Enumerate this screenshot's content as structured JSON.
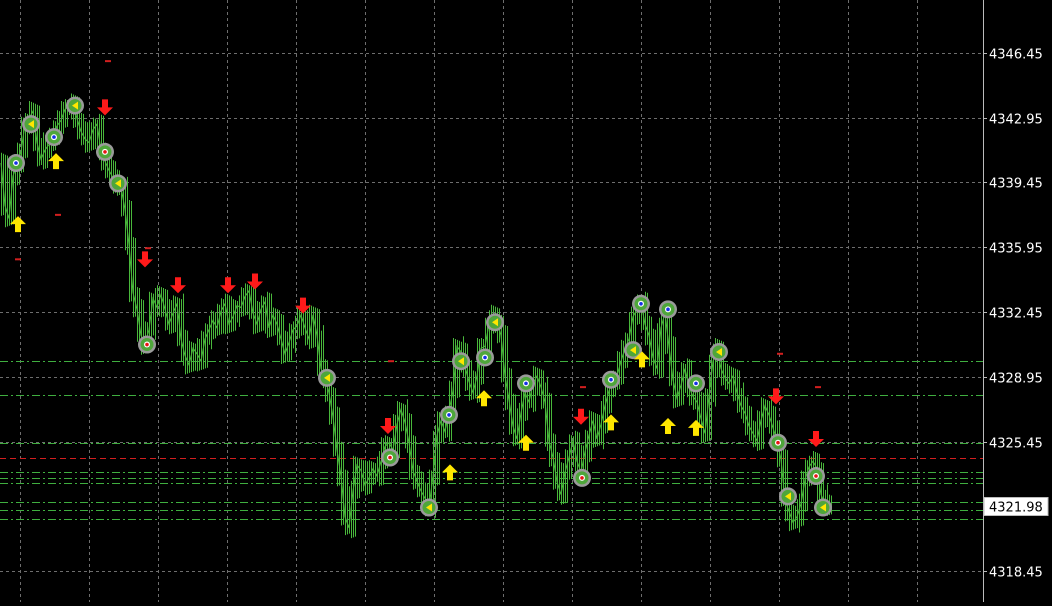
{
  "chart_data": {
    "type": "line",
    "title": "",
    "xlabel": "",
    "ylabel": "",
    "ylim": [
      4316.8,
      4349.3
    ],
    "grid": true,
    "y_ticks": [
      "4346.45",
      "4342.95",
      "4339.45",
      "4335.95",
      "4332.45",
      "4328.95",
      "4325.45",
      "4321.98",
      "4318.45"
    ],
    "current_price": "4321.98",
    "colors": {
      "background": "#000000",
      "grid": "#6e6e6e",
      "price": "#49b83b",
      "buy_arrow": "#ffe600",
      "sell_arrow": "#ff1a1a",
      "level_line": "#3fae3f",
      "red_level": "#d21f1f"
    },
    "series": [
      {
        "values": [
          [
            0,
            4340.5
          ],
          [
            4,
            4338.2
          ],
          [
            8,
            4337.5
          ],
          [
            12,
            4339.8
          ],
          [
            16,
            4340.4
          ],
          [
            20,
            4341.1
          ],
          [
            24,
            4342.6
          ],
          [
            28,
            4342.9
          ],
          [
            32,
            4343.3
          ],
          [
            36,
            4341.6
          ],
          [
            40,
            4340.7
          ],
          [
            44,
            4341.2
          ],
          [
            48,
            4341.5
          ],
          [
            52,
            4342.0
          ],
          [
            56,
            4342.5
          ],
          [
            60,
            4342.8
          ],
          [
            64,
            4343.4
          ],
          [
            68,
            4343.6
          ],
          [
            72,
            4343.7
          ],
          [
            76,
            4342.9
          ],
          [
            80,
            4342.2
          ],
          [
            84,
            4341.8
          ],
          [
            88,
            4341.6
          ],
          [
            92,
            4342.3
          ],
          [
            96,
            4342.6
          ],
          [
            100,
            4341.2
          ],
          [
            104,
            4340.6
          ],
          [
            108,
            4340.1
          ],
          [
            112,
            4339.7
          ],
          [
            116,
            4339.4
          ],
          [
            120,
            4339.2
          ],
          [
            124,
            4338.0
          ],
          [
            128,
            4336.1
          ],
          [
            132,
            4333.5
          ],
          [
            136,
            4332.6
          ],
          [
            140,
            4331.2
          ],
          [
            144,
            4330.7
          ],
          [
            148,
            4331.5
          ],
          [
            152,
            4333.2
          ],
          [
            156,
            4332.7
          ],
          [
            160,
            4333.4
          ],
          [
            164,
            4332.6
          ],
          [
            168,
            4331.8
          ],
          [
            172,
            4332.4
          ],
          [
            176,
            4332.9
          ],
          [
            180,
            4331.0
          ],
          [
            184,
            4330.1
          ],
          [
            188,
            4329.6
          ],
          [
            192,
            4330.5
          ],
          [
            196,
            4330.2
          ],
          [
            200,
            4329.8
          ],
          [
            204,
            4331.0
          ],
          [
            208,
            4331.5
          ],
          [
            212,
            4332.0
          ],
          [
            216,
            4331.6
          ],
          [
            220,
            4332.5
          ],
          [
            224,
            4332.9
          ],
          [
            228,
            4331.8
          ],
          [
            232,
            4332.2
          ],
          [
            236,
            4332.8
          ],
          [
            240,
            4332.7
          ],
          [
            244,
            4333.3
          ],
          [
            248,
            4333.6
          ],
          [
            252,
            4332.4
          ],
          [
            256,
            4331.8
          ],
          [
            260,
            4332.6
          ],
          [
            264,
            4333.0
          ],
          [
            268,
            4331.6
          ],
          [
            272,
            4332.3
          ],
          [
            276,
            4331.8
          ],
          [
            280,
            4331.0
          ],
          [
            284,
            4330.2
          ],
          [
            288,
            4330.8
          ],
          [
            292,
            4331.5
          ],
          [
            296,
            4331.7
          ],
          [
            300,
            4332.3
          ],
          [
            304,
            4331.6
          ],
          [
            308,
            4331.0
          ],
          [
            312,
            4332.3
          ],
          [
            316,
            4331.2
          ],
          [
            320,
            4329.4
          ],
          [
            324,
            4328.9
          ],
          [
            328,
            4328.1
          ],
          [
            332,
            4326.8
          ],
          [
            336,
            4325.0
          ],
          [
            340,
            4323.6
          ],
          [
            344,
            4321.4
          ],
          [
            348,
            4320.8
          ],
          [
            352,
            4322.8
          ],
          [
            356,
            4324.2
          ],
          [
            360,
            4323.9
          ],
          [
            364,
            4323.1
          ],
          [
            368,
            4323.5
          ],
          [
            372,
            4324.0
          ],
          [
            376,
            4323.6
          ],
          [
            380,
            4324.4
          ],
          [
            384,
            4325.2
          ],
          [
            388,
            4325.4
          ],
          [
            392,
            4325.0
          ],
          [
            396,
            4326.4
          ],
          [
            400,
            4327.2
          ],
          [
            404,
            4326.5
          ],
          [
            408,
            4325.4
          ],
          [
            412,
            4323.9
          ],
          [
            416,
            4323.3
          ],
          [
            420,
            4322.8
          ],
          [
            424,
            4322.4
          ],
          [
            428,
            4321.9
          ],
          [
            432,
            4323.6
          ],
          [
            436,
            4325.8
          ],
          [
            440,
            4326.6
          ],
          [
            444,
            4326.0
          ],
          [
            448,
            4327.1
          ],
          [
            452,
            4328.2
          ],
          [
            456,
            4330.6
          ],
          [
            460,
            4330.3
          ],
          [
            464,
            4329.5
          ],
          [
            468,
            4328.7
          ],
          [
            472,
            4328.1
          ],
          [
            476,
            4329.0
          ],
          [
            480,
            4330.5
          ],
          [
            484,
            4330.6
          ],
          [
            488,
            4331.8
          ],
          [
            492,
            4332.3
          ],
          [
            496,
            4332.0
          ],
          [
            500,
            4331.2
          ],
          [
            504,
            4329.0
          ],
          [
            508,
            4327.7
          ],
          [
            512,
            4326.3
          ],
          [
            516,
            4325.6
          ],
          [
            520,
            4327.0
          ],
          [
            524,
            4328.1
          ],
          [
            528,
            4327.6
          ],
          [
            532,
            4328.6
          ],
          [
            536,
            4329.0
          ],
          [
            540,
            4328.4
          ],
          [
            544,
            4327.6
          ],
          [
            548,
            4325.5
          ],
          [
            552,
            4324.6
          ],
          [
            556,
            4323.3
          ],
          [
            560,
            4322.6
          ],
          [
            564,
            4323.8
          ],
          [
            568,
            4324.6
          ],
          [
            572,
            4325.5
          ],
          [
            576,
            4324.4
          ],
          [
            580,
            4323.8
          ],
          [
            584,
            4324.9
          ],
          [
            588,
            4325.8
          ],
          [
            592,
            4326.6
          ],
          [
            596,
            4325.6
          ],
          [
            600,
            4326.4
          ],
          [
            604,
            4327.4
          ],
          [
            608,
            4328.2
          ],
          [
            612,
            4328.8
          ],
          [
            616,
            4329.0
          ],
          [
            620,
            4329.8
          ],
          [
            624,
            4330.5
          ],
          [
            628,
            4331.0
          ],
          [
            632,
            4332.2
          ],
          [
            636,
            4332.6
          ],
          [
            640,
            4333.0
          ],
          [
            644,
            4331.8
          ],
          [
            648,
            4331.2
          ],
          [
            652,
            4330.0
          ],
          [
            656,
            4329.4
          ],
          [
            660,
            4331.6
          ],
          [
            664,
            4332.4
          ],
          [
            668,
            4330.6
          ],
          [
            672,
            4328.8
          ],
          [
            676,
            4327.8
          ],
          [
            680,
            4328.5
          ],
          [
            684,
            4329.4
          ],
          [
            688,
            4328.4
          ],
          [
            692,
            4327.9
          ],
          [
            696,
            4327.6
          ],
          [
            700,
            4326.7
          ],
          [
            704,
            4325.9
          ],
          [
            708,
            4327.9
          ],
          [
            712,
            4329.8
          ],
          [
            716,
            4330.5
          ],
          [
            720,
            4329.4
          ],
          [
            724,
            4328.9
          ],
          [
            728,
            4328.6
          ],
          [
            732,
            4329.0
          ],
          [
            736,
            4328.1
          ],
          [
            740,
            4327.4
          ],
          [
            744,
            4327.0
          ],
          [
            748,
            4326.3
          ],
          [
            752,
            4325.9
          ],
          [
            756,
            4325.5
          ],
          [
            760,
            4326.6
          ],
          [
            764,
            4327.4
          ],
          [
            768,
            4326.9
          ],
          [
            772,
            4326.2
          ],
          [
            776,
            4325.5
          ],
          [
            780,
            4324.5
          ],
          [
            784,
            4322.3
          ],
          [
            788,
            4321.7
          ],
          [
            792,
            4321.1
          ],
          [
            796,
            4321.4
          ],
          [
            800,
            4322.1
          ],
          [
            804,
            4323.4
          ],
          [
            808,
            4324.1
          ],
          [
            812,
            4324.4
          ],
          [
            816,
            4324.0
          ],
          [
            820,
            4322.6
          ],
          [
            824,
            4322.1
          ],
          [
            828,
            4322.0
          ]
        ]
      }
    ],
    "signals": [
      {
        "type": "buy",
        "x": 17,
        "y": 4337.2
      },
      {
        "type": "buy",
        "x": 55,
        "y": 4340.6
      },
      {
        "type": "sell",
        "x": 104,
        "y": 4343.5
      },
      {
        "type": "sell",
        "x": 144,
        "y": 4335.3
      },
      {
        "type": "sell",
        "x": 177,
        "y": 4333.9
      },
      {
        "type": "sell",
        "x": 227,
        "y": 4333.9
      },
      {
        "type": "sell",
        "x": 254,
        "y": 4334.1
      },
      {
        "type": "sell",
        "x": 302,
        "y": 4332.8
      },
      {
        "type": "sell",
        "x": 387,
        "y": 4326.3
      },
      {
        "type": "buy",
        "x": 449,
        "y": 4323.8
      },
      {
        "type": "buy",
        "x": 483,
        "y": 4327.8
      },
      {
        "type": "buy",
        "x": 525,
        "y": 4325.4
      },
      {
        "type": "sell",
        "x": 580,
        "y": 4326.8
      },
      {
        "type": "buy",
        "x": 610,
        "y": 4326.5
      },
      {
        "type": "buy",
        "x": 641,
        "y": 4329.9
      },
      {
        "type": "buy",
        "x": 667,
        "y": 4326.3
      },
      {
        "type": "buy",
        "x": 695,
        "y": 4326.2
      },
      {
        "type": "sell",
        "x": 775,
        "y": 4327.9
      },
      {
        "type": "sell",
        "x": 815,
        "y": 4325.6
      }
    ],
    "markers": [
      {
        "kind": "blue",
        "x": 15,
        "y": 4340.5
      },
      {
        "kind": "yellow",
        "x": 30,
        "y": 4342.6
      },
      {
        "kind": "blue",
        "x": 53,
        "y": 4341.9
      },
      {
        "kind": "yellow",
        "x": 74,
        "y": 4343.6
      },
      {
        "kind": "red",
        "x": 104,
        "y": 4341.1
      },
      {
        "kind": "yellow",
        "x": 117,
        "y": 4339.4
      },
      {
        "kind": "red",
        "x": 146,
        "y": 4330.7
      },
      {
        "kind": "yellow",
        "x": 326,
        "y": 4328.9
      },
      {
        "kind": "red",
        "x": 389,
        "y": 4324.6
      },
      {
        "kind": "yellow",
        "x": 428,
        "y": 4321.9
      },
      {
        "kind": "blue",
        "x": 448,
        "y": 4326.9
      },
      {
        "kind": "yellow",
        "x": 460,
        "y": 4329.8
      },
      {
        "kind": "blue",
        "x": 484,
        "y": 4330.0
      },
      {
        "kind": "yellow",
        "x": 494,
        "y": 4331.9
      },
      {
        "kind": "blue",
        "x": 525,
        "y": 4328.6
      },
      {
        "kind": "red",
        "x": 581,
        "y": 4323.5
      },
      {
        "kind": "blue",
        "x": 610,
        "y": 4328.8
      },
      {
        "kind": "yellow",
        "x": 632,
        "y": 4330.4
      },
      {
        "kind": "blue",
        "x": 640,
        "y": 4332.9
      },
      {
        "kind": "blue",
        "x": 667,
        "y": 4332.6
      },
      {
        "kind": "blue",
        "x": 695,
        "y": 4328.6
      },
      {
        "kind": "yellow",
        "x": 718,
        "y": 4330.3
      },
      {
        "kind": "red",
        "x": 777,
        "y": 4325.4
      },
      {
        "kind": "yellow",
        "x": 787,
        "y": 4322.5
      },
      {
        "kind": "red",
        "x": 815,
        "y": 4323.6
      },
      {
        "kind": "yellow",
        "x": 822,
        "y": 4321.9
      }
    ],
    "levels": [
      {
        "price": 4329.8,
        "color": "#3fae3f",
        "style": "dashdot"
      },
      {
        "price": 4328.0,
        "color": "#3fae3f",
        "style": "dashdot"
      },
      {
        "price": 4325.4,
        "color": "#3fae3f",
        "style": "dashdot"
      },
      {
        "price": 4324.6,
        "color": "#d21f1f",
        "style": "dash"
      },
      {
        "price": 4323.8,
        "color": "#3fae3f",
        "style": "dashdot"
      },
      {
        "price": 4323.5,
        "color": "#3fae3f",
        "style": "dashdot"
      },
      {
        "price": 4323.2,
        "color": "#3fae3f",
        "style": "dashdot"
      },
      {
        "price": 4322.2,
        "color": "#3fae3f",
        "style": "dashdot"
      },
      {
        "price": 4321.75,
        "color": "#3fae3f",
        "style": "dashdot"
      },
      {
        "price": 4321.3,
        "color": "#3fae3f",
        "style": "dashdot"
      }
    ],
    "ticks_small": [
      {
        "x": 107,
        "y": 4346.0
      },
      {
        "x": 57,
        "y": 4337.7
      },
      {
        "x": 17,
        "y": 4335.3
      },
      {
        "x": 147,
        "y": 4335.9
      },
      {
        "x": 390,
        "y": 4329.8
      },
      {
        "x": 582,
        "y": 4328.4
      },
      {
        "x": 779,
        "y": 4330.2
      },
      {
        "x": 817,
        "y": 4328.4
      }
    ]
  }
}
